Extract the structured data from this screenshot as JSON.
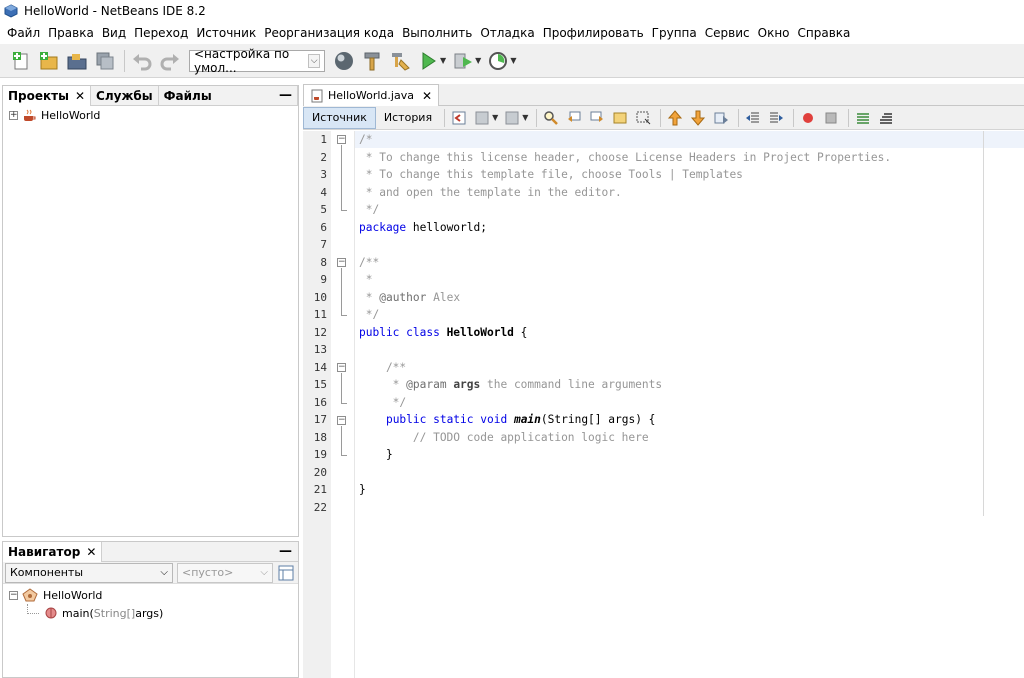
{
  "window": {
    "title": "HelloWorld - NetBeans IDE 8.2"
  },
  "menu": [
    "Файл",
    "Правка",
    "Вид",
    "Переход",
    "Источник",
    "Реорганизация кода",
    "Выполнить",
    "Отладка",
    "Профилировать",
    "Группа",
    "Сервис",
    "Окно",
    "Справка"
  ],
  "toolbar": {
    "config_value": "<настройка по умол..."
  },
  "projects_panel": {
    "tabs": [
      {
        "label": "Проекты",
        "close": "✕"
      },
      {
        "label": "Службы"
      },
      {
        "label": "Файлы"
      }
    ],
    "minimize": "—",
    "tree": [
      {
        "label": "HelloWorld",
        "expander": "+"
      }
    ]
  },
  "navigator_panel": {
    "tab_label": "Навигатор",
    "close": "✕",
    "minimize": "—",
    "filter_value": "Компоненты",
    "member_value": "<пусто>",
    "tree": [
      {
        "label": "HelloWorld",
        "expander": "−"
      },
      {
        "label_name": "main(",
        "label_type": "String[] ",
        "label_arg": "args)"
      }
    ]
  },
  "editor": {
    "file_tab": "HelloWorld.java",
    "file_tab_close": "✕",
    "mode_tabs": [
      "Источник",
      "История"
    ],
    "line_numbers": [
      "1",
      "2",
      "3",
      "4",
      "5",
      "6",
      "7",
      "8",
      "9",
      "10",
      "11",
      "12",
      "13",
      "14",
      "15",
      "16",
      "17",
      "18",
      "19",
      "20",
      "21",
      "22"
    ],
    "code": {
      "l1": "/*",
      "l2": " * To change this license header, choose License Headers in Project Properties.",
      "l3": " * To change this template file, choose Tools | Templates",
      "l4": " * and open the template in the editor.",
      "l5": " */",
      "l6_kw": "package",
      "l6_rest": " helloworld;",
      "l8": "/**",
      "l9": " *",
      "l10_pre": " * ",
      "l10_tag": "@author",
      "l10_rest": " Alex",
      "l11": " */",
      "l12_kw": "public class",
      "l12_name": " HelloWorld",
      "l12_rest": " {",
      "l14": "    /**",
      "l15_pre": "     * ",
      "l15_tag": "@param",
      "l15_arg": " args",
      "l15_rest": " the command line arguments",
      "l16": "     */",
      "l17_pre": "    ",
      "l17_kw": "public static void",
      "l17_sp": " ",
      "l17_name": "main",
      "l17_rest": "(String[] args) {",
      "l18": "        // TODO code application logic here",
      "l19": "    }",
      "l21": "}"
    }
  }
}
